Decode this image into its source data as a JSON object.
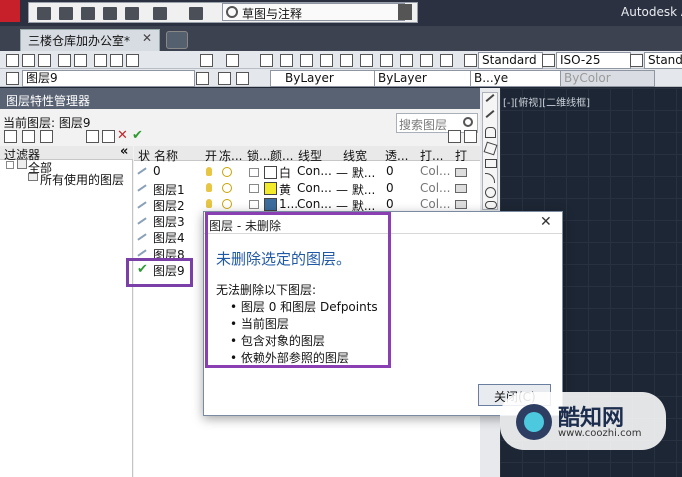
{
  "title_bar": {
    "workspace": "草图与注释",
    "app_title": "Autodesk A"
  },
  "tabs": {
    "document": "三楼仓库加办公室*",
    "close": "✕"
  },
  "toolbar_top": {
    "text_style": "Standard",
    "dim_style": "ISO-25",
    "table_style": "Standa"
  },
  "toolbar_props": {
    "current_layer": "图层9",
    "color": "ByLayer",
    "linetype": "ByLayer",
    "lineweight": "B...ye",
    "plotstyle": "ByColor"
  },
  "layer_manager": {
    "title": "图层特性管理器",
    "current_layer_label": "当前图层: 图层9",
    "search_placeholder": "搜索图层",
    "tree": {
      "filter_label": "过滤器",
      "collapse": "«",
      "all": "全部",
      "used": "所有使用的图层"
    },
    "columns": [
      "状",
      "名称",
      "开",
      "冻...",
      "锁...",
      "颜...",
      "线型",
      "线宽",
      "透...",
      "打...",
      "打"
    ],
    "rows": [
      {
        "name": "0",
        "color_name": "白",
        "color_hex": "#ffffff",
        "linetype": "Con...",
        "lineweight": "— 默...",
        "transparency": "0",
        "plot_style": "Col..."
      },
      {
        "name": "图层1",
        "color_name": "黄",
        "color_hex": "#f3ea2b",
        "linetype": "Con...",
        "lineweight": "— 默...",
        "transparency": "0",
        "plot_style": "Col..."
      },
      {
        "name": "图层2",
        "color_name": "1...",
        "color_hex": "#3d6c9e",
        "linetype": "Con...",
        "lineweight": "— 默...",
        "transparency": "0",
        "plot_style": "Col..."
      },
      {
        "name": "图层3"
      },
      {
        "name": "图层4"
      },
      {
        "name": "图层8"
      },
      {
        "name": "图层9",
        "current": true
      }
    ],
    "check_mark": "✔"
  },
  "viewport": {
    "label": "[-][俯视][二维线框]"
  },
  "dialog": {
    "title": "图层 - 未删除",
    "close": "✕",
    "main": "未删除选定的图层。",
    "sub": "无法删除以下图层:",
    "bullets": [
      "• 图层 0 和图层 Defpoints",
      "• 当前图层",
      "• 包含对象的图层",
      "• 依赖外部参照的图层"
    ],
    "button": "关闭(C)"
  },
  "watermark": {
    "name": "酷知网",
    "url": "www.coozhi.com"
  },
  "colors": {
    "highlight": "#7b3fa8",
    "dialog_heading": "#1f58a5",
    "viewport_bg": "#1d2634"
  }
}
